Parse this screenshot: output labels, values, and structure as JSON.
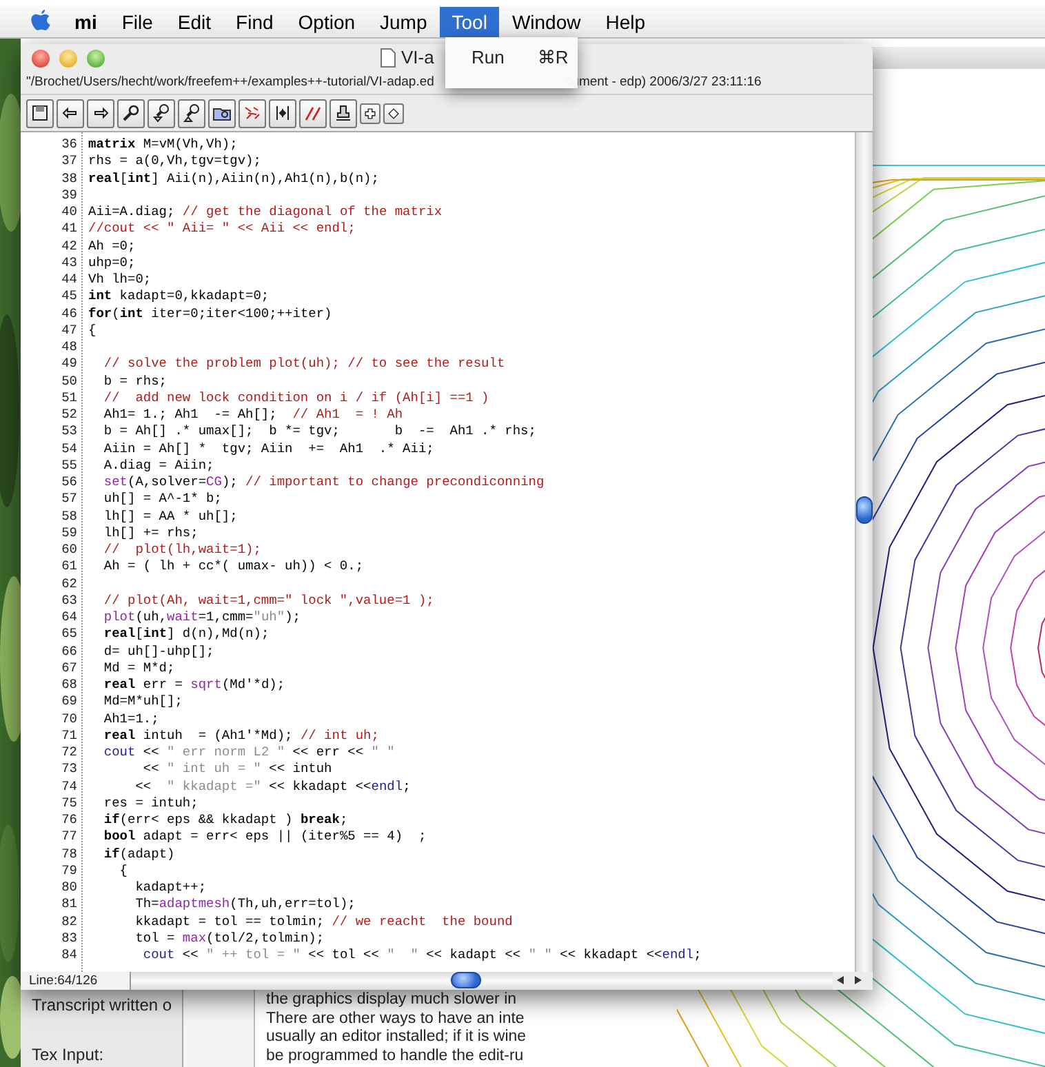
{
  "menu_bar": {
    "items": [
      {
        "label": "mi",
        "kind": "app",
        "selected": false
      },
      {
        "label": "File",
        "kind": "menu",
        "selected": false
      },
      {
        "label": "Edit",
        "kind": "menu",
        "selected": false
      },
      {
        "label": "Find",
        "kind": "menu",
        "selected": false
      },
      {
        "label": "Option",
        "kind": "menu",
        "selected": false
      },
      {
        "label": "Jump",
        "kind": "menu",
        "selected": false
      },
      {
        "label": "Tool",
        "kind": "menu",
        "selected": true
      },
      {
        "label": "Window",
        "kind": "menu",
        "selected": false
      },
      {
        "label": "Help",
        "kind": "menu",
        "selected": false
      }
    ]
  },
  "dropdown": {
    "items": [
      {
        "label": "Run",
        "shortcut": "⌘R"
      }
    ]
  },
  "editor": {
    "title": "VI-a",
    "path": "\"/Brochet/Users/hecht/work/freefem++/examples++-tutorial/VI-adap.ed",
    "path_end": "cument - edp)  2006/3/27  23:11:16",
    "toolbar": [
      {
        "kind": "save"
      },
      {
        "kind": "undo"
      },
      {
        "kind": "redo"
      },
      {
        "kind": "find"
      },
      {
        "kind": "find-down"
      },
      {
        "kind": "find-up"
      },
      {
        "kind": "folder-find"
      },
      {
        "kind": "marks"
      },
      {
        "kind": "shift"
      },
      {
        "kind": "comment"
      },
      {
        "kind": "stamp"
      },
      {
        "kind": "plus"
      },
      {
        "kind": "diamond"
      }
    ],
    "lines": [
      {
        "number": "36",
        "segments": [
          {
            "kind": "keyword",
            "text": "matrix"
          },
          {
            "kind": "plain",
            "text": " M=vM(Vh,Vh);"
          }
        ]
      },
      {
        "number": "37",
        "segments": [
          {
            "kind": "plain",
            "text": "rhs = a(0,Vh,tgv=tgv);"
          }
        ]
      },
      {
        "number": "38",
        "segments": [
          {
            "kind": "keyword",
            "text": "real"
          },
          {
            "kind": "plain",
            "text": "["
          },
          {
            "kind": "keyword",
            "text": "int"
          },
          {
            "kind": "plain",
            "text": "] Aii(n),Aiin(n),Ah1(n),b(n);"
          }
        ]
      },
      {
        "number": "39"
      },
      {
        "number": "40",
        "segments": [
          {
            "kind": "plain",
            "text": "Aii=A.diag; "
          },
          {
            "kind": "comment",
            "text": "// get the diagonal of the matrix"
          }
        ]
      },
      {
        "number": "41",
        "segments": [
          {
            "kind": "comment",
            "text": "//cout << \" Aii= \" << Aii << endl;"
          }
        ]
      },
      {
        "number": "42",
        "segments": [
          {
            "kind": "plain",
            "text": "Ah =0;"
          }
        ]
      },
      {
        "number": "43",
        "segments": [
          {
            "kind": "plain",
            "text": "uhp=0;"
          }
        ]
      },
      {
        "number": "44",
        "segments": [
          {
            "kind": "plain",
            "text": "Vh lh=0;"
          }
        ]
      },
      {
        "number": "45",
        "segments": [
          {
            "kind": "keyword",
            "text": "int"
          },
          {
            "kind": "plain",
            "text": " kadapt=0,kkadapt=0;"
          }
        ]
      },
      {
        "number": "46",
        "segments": [
          {
            "kind": "keyword",
            "text": "for"
          },
          {
            "kind": "plain",
            "text": "("
          },
          {
            "kind": "keyword",
            "text": "int"
          },
          {
            "kind": "plain",
            "text": " iter=0;iter<100;++iter)"
          }
        ]
      },
      {
        "number": "47",
        "segments": [
          {
            "kind": "plain",
            "text": "{"
          }
        ]
      },
      {
        "number": "48"
      },
      {
        "number": "49",
        "segments": [
          {
            "kind": "comment",
            "text": "  // solve the problem plot(uh); // to see the result"
          }
        ]
      },
      {
        "number": "50",
        "segments": [
          {
            "kind": "plain",
            "text": "  b = rhs;"
          }
        ]
      },
      {
        "number": "51",
        "segments": [
          {
            "kind": "comment",
            "text": "  //  add new lock condition on i / if (Ah[i] ==1 )"
          }
        ]
      },
      {
        "number": "52",
        "segments": [
          {
            "kind": "plain",
            "text": "  Ah1= 1.; Ah1  -= Ah[];  "
          },
          {
            "kind": "comment",
            "text": "// Ah1  = ! Ah"
          }
        ]
      },
      {
        "number": "53",
        "segments": [
          {
            "kind": "plain",
            "text": "  b = Ah[] .* umax[];  b *= tgv;       b  -=  Ah1 .* rhs;"
          }
        ]
      },
      {
        "number": "54",
        "segments": [
          {
            "kind": "plain",
            "text": "  Aiin = Ah[] *  tgv; Aiin  +=  Ah1  .* Aii;"
          }
        ]
      },
      {
        "number": "55",
        "segments": [
          {
            "kind": "plain",
            "text": "  A.diag = Aiin;"
          }
        ]
      },
      {
        "number": "56",
        "segments": [
          {
            "kind": "function",
            "text": "  set"
          },
          {
            "kind": "plain",
            "text": "(A,solver="
          },
          {
            "kind": "function",
            "text": "CG"
          },
          {
            "kind": "plain",
            "text": "); "
          },
          {
            "kind": "comment",
            "text": "// important to change precondiconning"
          }
        ]
      },
      {
        "number": "57",
        "segments": [
          {
            "kind": "plain",
            "text": "  uh[] = A^-1* b;"
          }
        ]
      },
      {
        "number": "58",
        "segments": [
          {
            "kind": "plain",
            "text": "  lh[] = AA * uh[];"
          }
        ]
      },
      {
        "number": "59",
        "segments": [
          {
            "kind": "plain",
            "text": "  lh[] += rhs;"
          }
        ]
      },
      {
        "number": "60",
        "segments": [
          {
            "kind": "comment",
            "text": "  //  plot(lh,wait=1);"
          }
        ]
      },
      {
        "number": "61",
        "segments": [
          {
            "kind": "plain",
            "text": "  Ah = ( lh + cc*( umax- uh)) < 0.;"
          }
        ]
      },
      {
        "number": "62"
      },
      {
        "number": "63",
        "segments": [
          {
            "kind": "comment",
            "text": "  // plot(Ah, wait=1,cmm=\" lock \",value=1 );"
          }
        ]
      },
      {
        "number": "64",
        "segments": [
          {
            "kind": "function",
            "text": "  plot"
          },
          {
            "kind": "plain",
            "text": "(uh,"
          },
          {
            "kind": "function",
            "text": "wait"
          },
          {
            "kind": "plain",
            "text": "=1,cmm="
          },
          {
            "kind": "string",
            "text": "\"uh\""
          },
          {
            "kind": "plain",
            "text": ");"
          }
        ]
      },
      {
        "number": "65",
        "segments": [
          {
            "kind": "keyword",
            "text": "  real"
          },
          {
            "kind": "plain",
            "text": "["
          },
          {
            "kind": "keyword",
            "text": "int"
          },
          {
            "kind": "plain",
            "text": "] d(n),Md(n);"
          }
        ]
      },
      {
        "number": "66",
        "segments": [
          {
            "kind": "plain",
            "text": "  d= uh[]-uhp[];"
          }
        ]
      },
      {
        "number": "67",
        "segments": [
          {
            "kind": "plain",
            "text": "  Md = M*d;"
          }
        ]
      },
      {
        "number": "68",
        "segments": [
          {
            "kind": "keyword",
            "text": "  real"
          },
          {
            "kind": "plain",
            "text": " err = "
          },
          {
            "kind": "function",
            "text": "sqrt"
          },
          {
            "kind": "plain",
            "text": "(Md'*d);"
          }
        ]
      },
      {
        "number": "69",
        "segments": [
          {
            "kind": "plain",
            "text": "  Md=M*uh[];"
          }
        ]
      },
      {
        "number": "70",
        "segments": [
          {
            "kind": "plain",
            "text": "  Ah1=1.;"
          }
        ]
      },
      {
        "number": "71",
        "segments": [
          {
            "kind": "keyword",
            "text": "  real"
          },
          {
            "kind": "plain",
            "text": " intuh  = (Ah1'*Md); "
          },
          {
            "kind": "comment",
            "text": "// int uh;"
          }
        ]
      },
      {
        "number": "72",
        "segments": [
          {
            "kind": "stream",
            "text": "  cout"
          },
          {
            "kind": "plain",
            "text": " << "
          },
          {
            "kind": "string",
            "text": "\" err norm L2 \""
          },
          {
            "kind": "plain",
            "text": " << err << "
          },
          {
            "kind": "string",
            "text": "\" \""
          }
        ]
      },
      {
        "number": "73",
        "segments": [
          {
            "kind": "plain",
            "text": "       << "
          },
          {
            "kind": "string",
            "text": "\" int uh = \""
          },
          {
            "kind": "plain",
            "text": " << intuh"
          }
        ]
      },
      {
        "number": "74",
        "segments": [
          {
            "kind": "plain",
            "text": "      <<  "
          },
          {
            "kind": "string",
            "text": "\" kkadapt =\""
          },
          {
            "kind": "plain",
            "text": " << kkadapt <<"
          },
          {
            "kind": "stream",
            "text": "endl"
          },
          {
            "kind": "plain",
            "text": ";"
          }
        ]
      },
      {
        "number": "75",
        "segments": [
          {
            "kind": "plain",
            "text": "  res = intuh;"
          }
        ]
      },
      {
        "number": "76",
        "segments": [
          {
            "kind": "keyword",
            "text": "  if"
          },
          {
            "kind": "plain",
            "text": "(err< eps && kkadapt ) "
          },
          {
            "kind": "keyword",
            "text": "break"
          },
          {
            "kind": "plain",
            "text": ";"
          }
        ]
      },
      {
        "number": "77",
        "segments": [
          {
            "kind": "keyword",
            "text": "  bool"
          },
          {
            "kind": "plain",
            "text": " adapt = err< eps || (iter%5 == 4)  ;"
          }
        ]
      },
      {
        "number": "78",
        "segments": [
          {
            "kind": "keyword",
            "text": "  if"
          },
          {
            "kind": "plain",
            "text": "(adapt)"
          }
        ]
      },
      {
        "number": "79",
        "segments": [
          {
            "kind": "plain",
            "text": "    {"
          }
        ]
      },
      {
        "number": "80",
        "segments": [
          {
            "kind": "plain",
            "text": "      kadapt++;"
          }
        ]
      },
      {
        "number": "81",
        "segments": [
          {
            "kind": "plain",
            "text": "      Th="
          },
          {
            "kind": "function",
            "text": "adaptmesh"
          },
          {
            "kind": "plain",
            "text": "(Th,uh,err=tol);"
          }
        ]
      },
      {
        "number": "82",
        "segments": [
          {
            "kind": "plain",
            "text": "      kkadapt = tol == tolmin; "
          },
          {
            "kind": "comment",
            "text": "// we reacht  the bound"
          }
        ]
      },
      {
        "number": "83",
        "segments": [
          {
            "kind": "plain",
            "text": "      tol = "
          },
          {
            "kind": "function",
            "text": "max"
          },
          {
            "kind": "plain",
            "text": "(tol/2,tolmin);"
          }
        ]
      },
      {
        "number": "84",
        "segments": [
          {
            "kind": "stream",
            "text": "       cout"
          },
          {
            "kind": "plain",
            "text": " << "
          },
          {
            "kind": "string",
            "text": "\" ++ tol = \""
          },
          {
            "kind": "plain",
            "text": " << tol << "
          },
          {
            "kind": "string",
            "text": "\"  \""
          },
          {
            "kind": "plain",
            "text": " << kadapt << "
          },
          {
            "kind": "string",
            "text": "\" \""
          },
          {
            "kind": "plain",
            "text": " << kkadapt <<"
          },
          {
            "kind": "stream",
            "text": "endl"
          },
          {
            "kind": "plain",
            "text": ";"
          }
        ]
      }
    ],
    "status": "Line:64/126"
  },
  "back_window": {
    "sidebar": [
      "Transcript written o",
      "Tex Input:"
    ],
    "text_lines": [
      "the graphics display much slower in",
      "There are other ways to have an inte",
      "usually an editor installed; if it is wine",
      "be programmed to handle the edit-ru"
    ]
  }
}
